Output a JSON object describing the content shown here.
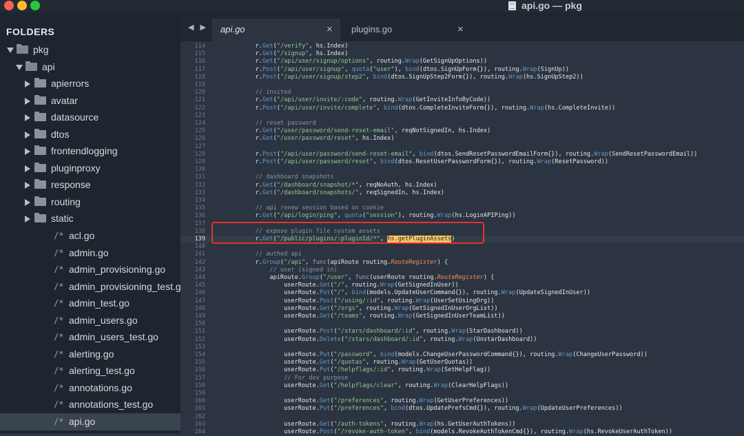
{
  "window": {
    "title": "api.go — pkg"
  },
  "sidebar": {
    "header": "FOLDERS",
    "items": [
      {
        "label": "pkg",
        "kind": "folder-open",
        "depth": 0
      },
      {
        "label": "api",
        "kind": "folder-open",
        "depth": 1
      },
      {
        "label": "apierrors",
        "kind": "folder",
        "depth": 2
      },
      {
        "label": "avatar",
        "kind": "folder",
        "depth": 2
      },
      {
        "label": "datasource",
        "kind": "folder",
        "depth": 2
      },
      {
        "label": "dtos",
        "kind": "folder",
        "depth": 2
      },
      {
        "label": "frontendlogging",
        "kind": "folder",
        "depth": 2
      },
      {
        "label": "pluginproxy",
        "kind": "folder",
        "depth": 2
      },
      {
        "label": "response",
        "kind": "folder",
        "depth": 2
      },
      {
        "label": "routing",
        "kind": "folder",
        "depth": 2
      },
      {
        "label": "static",
        "kind": "folder",
        "depth": 2
      },
      {
        "label": "acl.go",
        "kind": "file",
        "depth": 2
      },
      {
        "label": "admin.go",
        "kind": "file",
        "depth": 2
      },
      {
        "label": "admin_provisioning.go",
        "kind": "file",
        "depth": 2
      },
      {
        "label": "admin_provisioning_test.go",
        "kind": "file",
        "depth": 2
      },
      {
        "label": "admin_test.go",
        "kind": "file",
        "depth": 2
      },
      {
        "label": "admin_users.go",
        "kind": "file",
        "depth": 2
      },
      {
        "label": "admin_users_test.go",
        "kind": "file",
        "depth": 2
      },
      {
        "label": "alerting.go",
        "kind": "file",
        "depth": 2
      },
      {
        "label": "alerting_test.go",
        "kind": "file",
        "depth": 2
      },
      {
        "label": "annotations.go",
        "kind": "file",
        "depth": 2
      },
      {
        "label": "annotations_test.go",
        "kind": "file",
        "depth": 2
      },
      {
        "label": "api.go",
        "kind": "file",
        "depth": 2,
        "selected": true
      }
    ],
    "file_glyph": "/*"
  },
  "editor": {
    "nav_arrows": "◀ ▶",
    "tabs": [
      {
        "label": "api.go",
        "active": true,
        "close": "×"
      },
      {
        "label": "plugins.go",
        "active": false,
        "close": "×"
      }
    ],
    "current_line": 139,
    "first_line": 114,
    "lines": [
      "\tr.Get(\"/verify\", hs.Index)",
      "\tr.Get(\"/signup\", hs.Index)",
      "\tr.Get(\"/api/user/signup/options\", routing.Wrap(GetSignUpOptions))",
      "\tr.Post(\"/api/user/signup\", quota(\"user\"), bind(dtos.SignUpForm{}), routing.Wrap(SignUp))",
      "\tr.Post(\"/api/user/signup/step2\", bind(dtos.SignUpStep2Form{}), routing.Wrap(hs.SignUpStep2))",
      "",
      "\t// invited",
      "\tr.Get(\"/api/user/invite/:code\", routing.Wrap(GetInviteInfoByCode))",
      "\tr.Post(\"/api/user/invite/complete\", bind(dtos.CompleteInviteForm{}), routing.Wrap(hs.CompleteInvite))",
      "",
      "\t// reset password",
      "\tr.Get(\"/user/password/send-reset-email\", reqNotSignedIn, hs.Index)",
      "\tr.Get(\"/user/password/reset\", hs.Index)",
      "",
      "\tr.Post(\"/api/user/password/send-reset-email\", bind(dtos.SendResetPasswordEmailForm{}), routing.Wrap(SendResetPasswordEmail))",
      "\tr.Post(\"/api/user/password/reset\", bind(dtos.ResetUserPasswordForm{}), routing.Wrap(ResetPassword))",
      "",
      "\t// dashboard snapshots",
      "\tr.Get(\"/dashboard/snapshot/*\", reqNoAuth, hs.Index)",
      "\tr.Get(\"/dashboard/snapshots/\", reqSignedIn, hs.Index)",
      "",
      "\t// api renew session based on cookie",
      "\tr.Get(\"/api/login/ping\", quota(\"session\"), routing.Wrap(hs.LoginAPIPing))",
      "",
      "\t// expose plugin file system assets",
      "\tr.Get(\"/public/plugins/:pluginId/*\", hs.getPluginAssets)",
      "",
      "\t// authed api",
      "\tr.Group(\"/api\", func(apiRoute routing.RouteRegister) {",
      "\t\t// user (signed in)",
      "\t\tapiRoute.Group(\"/user\", func(userRoute routing.RouteRegister) {",
      "\t\t\tuserRoute.Get(\"/\", routing.Wrap(GetSignedInUser))",
      "\t\t\tuserRoute.Put(\"/\", bind(models.UpdateUserCommand{}), routing.Wrap(UpdateSignedInUser))",
      "\t\t\tuserRoute.Post(\"/using/:id\", routing.Wrap(UserSetUsingOrg))",
      "\t\t\tuserRoute.Get(\"/orgs\", routing.Wrap(GetSignedInUserOrgList))",
      "\t\t\tuserRoute.Get(\"/teams\", routing.Wrap(GetSignedInUserTeamList))",
      "",
      "\t\t\tuserRoute.Post(\"/stars/dashboard/:id\", routing.Wrap(StarDashboard))",
      "\t\t\tuserRoute.Delete(\"/stars/dashboard/:id\", routing.Wrap(UnstarDashboard))",
      "",
      "\t\t\tuserRoute.Put(\"/password\", bind(models.ChangeUserPasswordCommand{}), routing.Wrap(ChangeUserPassword))",
      "\t\t\tuserRoute.Get(\"/quotas\", routing.Wrap(GetUserQuotas))",
      "\t\t\tuserRoute.Put(\"/helpflags/:id\", routing.Wrap(SetHelpFlag))",
      "\t\t\t// For dev purpose",
      "\t\t\tuserRoute.Get(\"/helpflags/clear\", routing.Wrap(ClearHelpFlags))",
      "",
      "\t\t\tuserRoute.Get(\"/preferences\", routing.Wrap(GetUserPreferences))",
      "\t\t\tuserRoute.Put(\"/preferences\", bind(dtos.UpdatePrefsCmd{}), routing.Wrap(UpdateUserPreferences))",
      "",
      "\t\t\tuserRoute.Get(\"/auth-tokens\", routing.Wrap(hs.GetUserAuthTokens))",
      "\t\t\tuserRoute.Post(\"/revoke-auth-token\", bind(models.RevokeAuthTokenCmd{}), routing.Wrap(hs.RevokeUserAuthToken))"
    ],
    "highlight_text": "hs.getPluginAssets"
  },
  "colors": {
    "annotation_box": "#e8322f",
    "selection": "#fac863"
  }
}
